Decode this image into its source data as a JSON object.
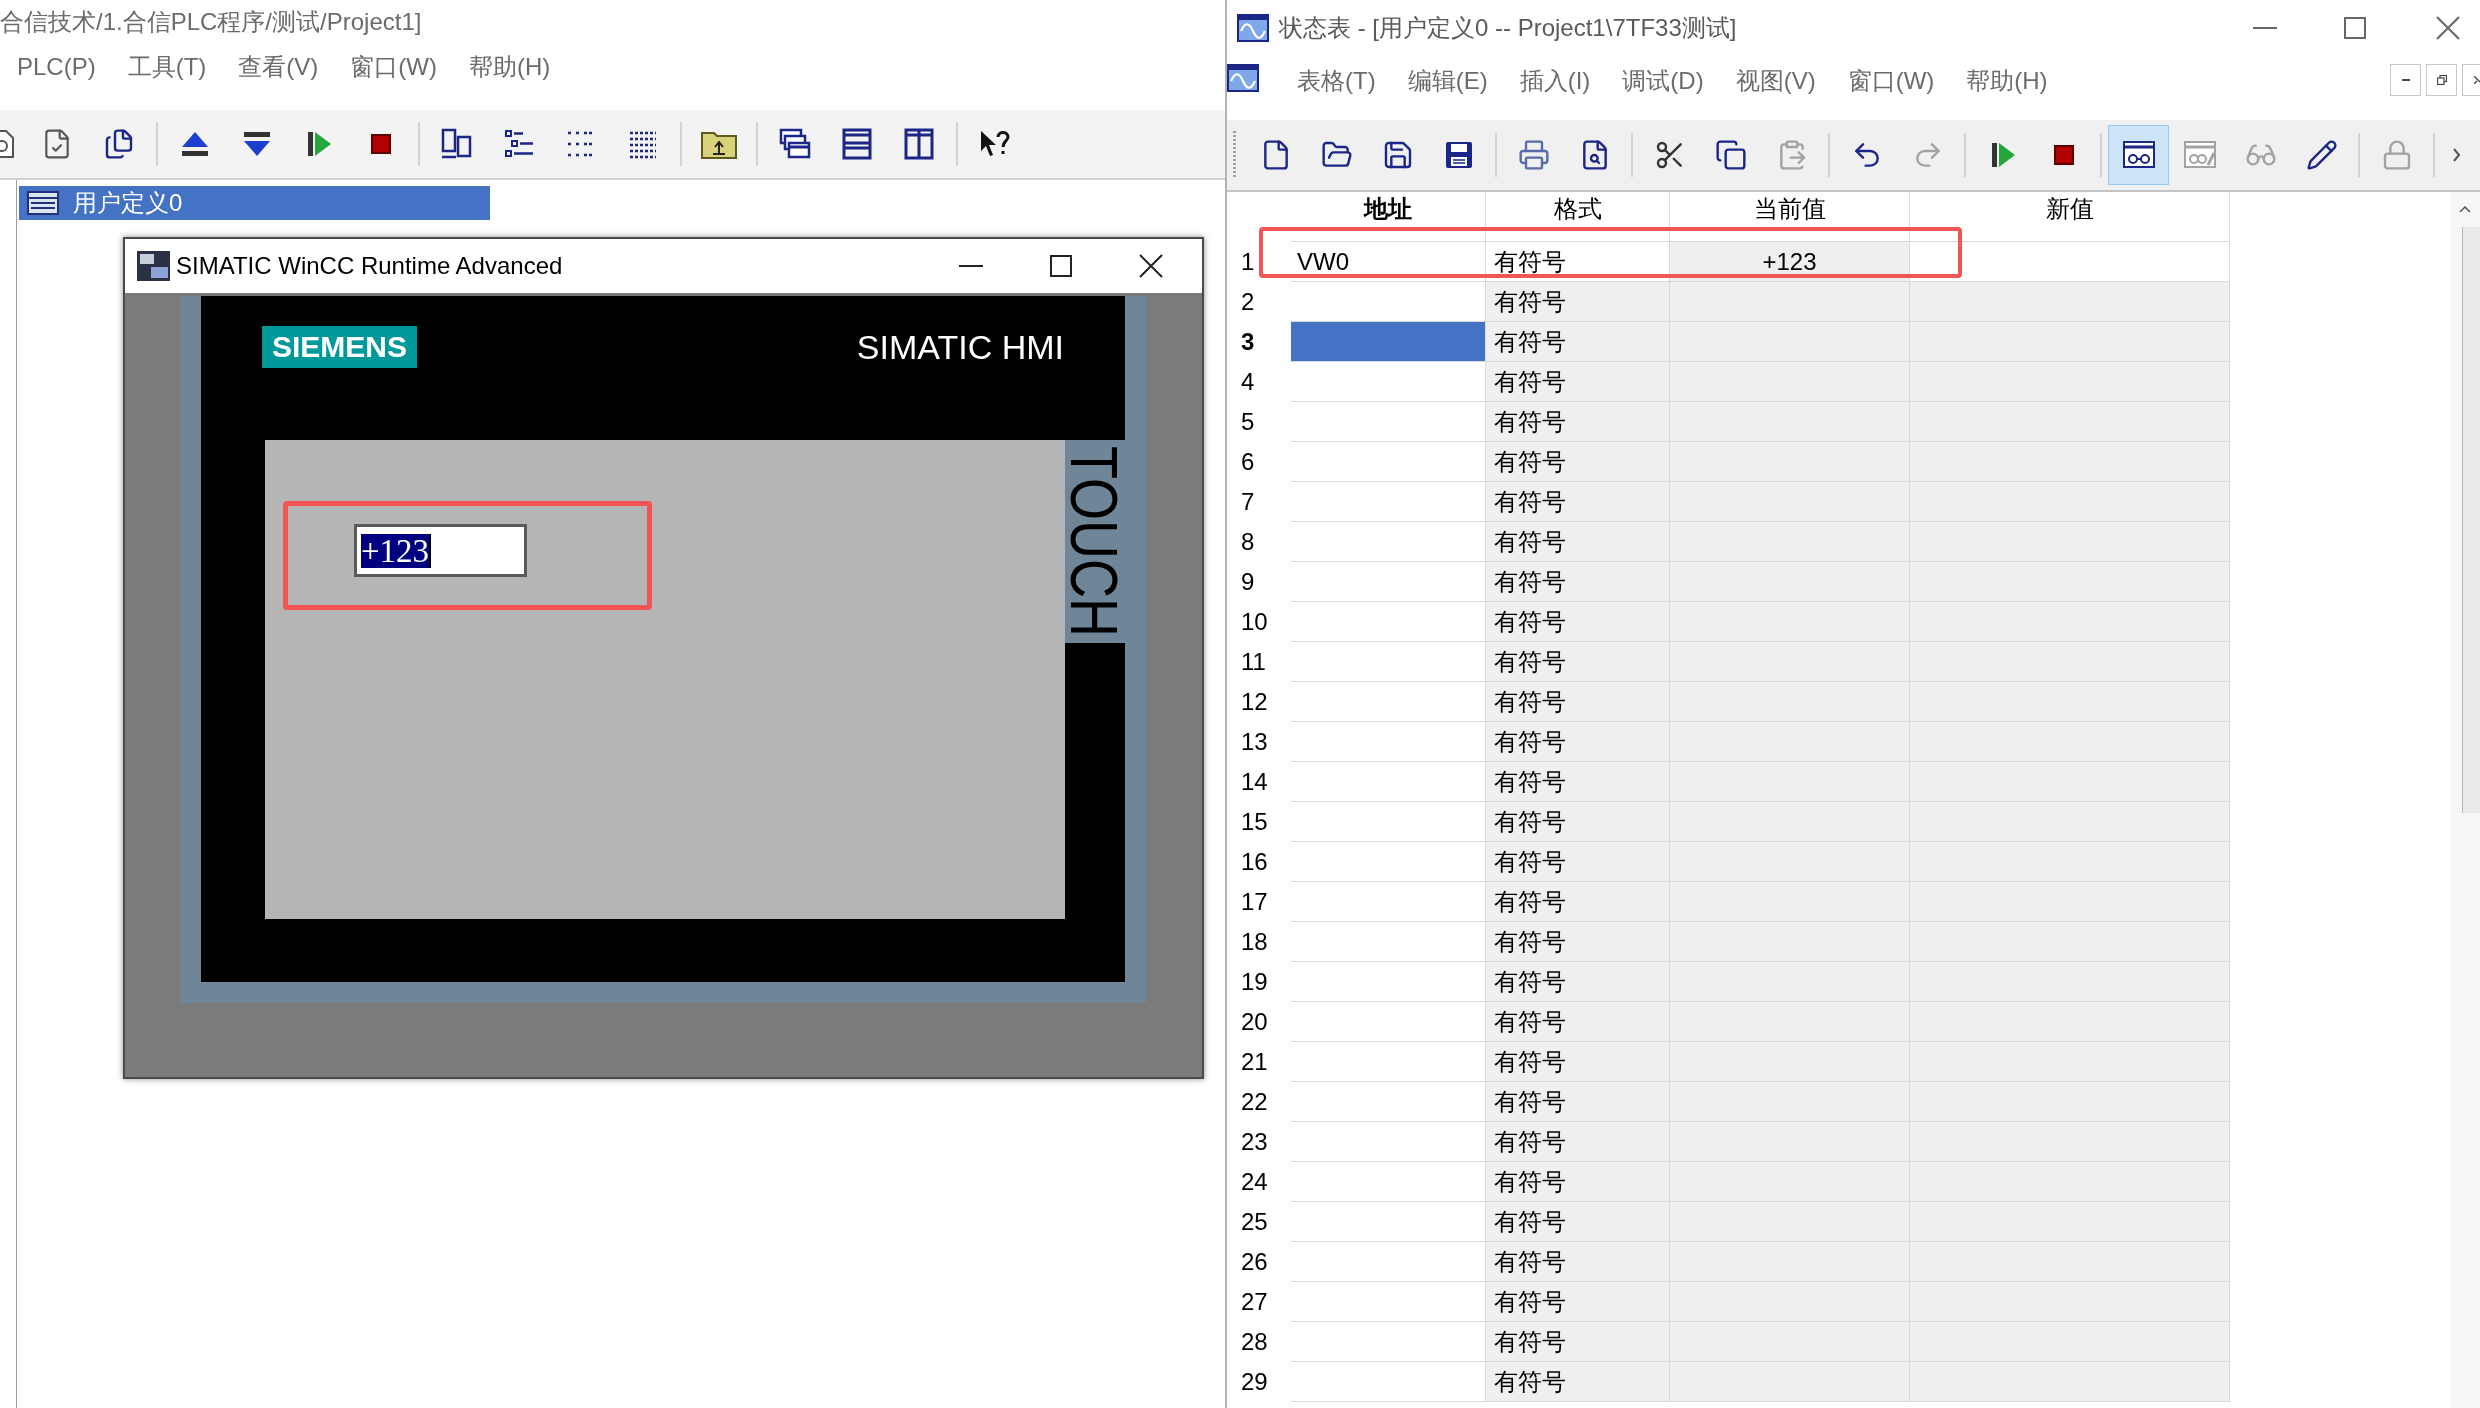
{
  "main_window": {
    "title": "合信技术/1.合信PLC程序/测试/Project1]",
    "menu": [
      "PLC(P)",
      "工具(T)",
      "查看(V)",
      "窗口(W)",
      "帮助(H)"
    ],
    "tree": [
      {
        "label": "用户定义0",
        "selected": true
      }
    ]
  },
  "hmi_window": {
    "title": "SIMATIC WinCC Runtime Advanced",
    "brand": "SIEMENS",
    "panel_label": "SIMATIC HMI",
    "touch_label": "TOUCH",
    "io_field": {
      "value": "+123",
      "selected": true,
      "highlighted": true
    }
  },
  "status_chart": {
    "title": "状态表 - [用户定义0 -- Project1\\7TF33测试]",
    "menu": [
      "表格(T)",
      "编辑(E)",
      "插入(I)",
      "调试(D)",
      "视图(V)",
      "窗口(W)",
      "帮助(H)"
    ],
    "toolbar": [
      {
        "selected": false,
        "disabled": false
      },
      {
        "selected": false,
        "disabled": false
      },
      {
        "selected": false,
        "disabled": false
      },
      {
        "selected": false,
        "disabled": false
      },
      {
        "selected": false,
        "disabled": false
      },
      {
        "selected": false,
        "disabled": false
      },
      {
        "selected": false,
        "disabled": false
      },
      {
        "selected": false,
        "disabled": false
      },
      {
        "selected": false,
        "disabled": true
      },
      {
        "selected": false,
        "disabled": false
      },
      {
        "selected": false,
        "disabled": true
      },
      {
        "selected": false,
        "disabled": false
      },
      {
        "selected": false,
        "disabled": false
      },
      {
        "selected": true,
        "disabled": false
      },
      {
        "selected": false,
        "disabled": true
      },
      {
        "selected": false,
        "disabled": true
      },
      {
        "selected": false,
        "disabled": false
      },
      {
        "selected": false,
        "disabled": true
      }
    ],
    "columns": [
      {
        "label": "地址",
        "selected": true
      },
      {
        "label": "格式",
        "selected": false
      },
      {
        "label": "当前值",
        "selected": false
      },
      {
        "label": "新值",
        "selected": false
      }
    ],
    "rows": [
      {
        "number": "1",
        "address": "VW0",
        "format": "有符号",
        "current_value": "+123",
        "selected": false,
        "disabled": false,
        "highlighted": true
      },
      {
        "number": "2",
        "format": "有符号",
        "selected": false,
        "disabled": true,
        "highlighted": false
      },
      {
        "number": "3",
        "format": "有符号",
        "selected": true,
        "disabled": true,
        "highlighted": false
      },
      {
        "number": "4",
        "format": "有符号",
        "selected": false,
        "disabled": true,
        "highlighted": false
      },
      {
        "number": "5",
        "format": "有符号",
        "selected": false,
        "disabled": true,
        "highlighted": false
      },
      {
        "number": "6",
        "format": "有符号",
        "selected": false,
        "disabled": true,
        "highlighted": false
      },
      {
        "number": "7",
        "format": "有符号",
        "selected": false,
        "disabled": true,
        "highlighted": false
      },
      {
        "number": "8",
        "format": "有符号",
        "selected": false,
        "disabled": true,
        "highlighted": false
      },
      {
        "number": "9",
        "format": "有符号",
        "selected": false,
        "disabled": true,
        "highlighted": false
      },
      {
        "number": "10",
        "format": "有符号",
        "selected": false,
        "disabled": true,
        "highlighted": false
      },
      {
        "number": "11",
        "format": "有符号",
        "selected": false,
        "disabled": true,
        "highlighted": false
      },
      {
        "number": "12",
        "format": "有符号",
        "selected": false,
        "disabled": true,
        "highlighted": false
      },
      {
        "number": "13",
        "format": "有符号",
        "selected": false,
        "disabled": true,
        "highlighted": false
      },
      {
        "number": "14",
        "format": "有符号",
        "selected": false,
        "disabled": true,
        "highlighted": false
      },
      {
        "number": "15",
        "format": "有符号",
        "selected": false,
        "disabled": true,
        "highlighted": false
      },
      {
        "number": "16",
        "format": "有符号",
        "selected": false,
        "disabled": true,
        "highlighted": false
      },
      {
        "number": "17",
        "format": "有符号",
        "selected": false,
        "disabled": true,
        "highlighted": false
      },
      {
        "number": "18",
        "format": "有符号",
        "selected": false,
        "disabled": true,
        "highlighted": false
      },
      {
        "number": "19",
        "format": "有符号",
        "selected": false,
        "disabled": true,
        "highlighted": false
      },
      {
        "number": "20",
        "format": "有符号",
        "selected": false,
        "disabled": true,
        "highlighted": false
      },
      {
        "number": "21",
        "format": "有符号",
        "selected": false,
        "disabled": true,
        "highlighted": false
      },
      {
        "number": "22",
        "format": "有符号",
        "selected": false,
        "disabled": true,
        "highlighted": false
      },
      {
        "number": "23",
        "format": "有符号",
        "selected": false,
        "disabled": true,
        "highlighted": false
      },
      {
        "number": "24",
        "format": "有符号",
        "selected": false,
        "disabled": true,
        "highlighted": false
      },
      {
        "number": "25",
        "format": "有符号",
        "selected": false,
        "disabled": true,
        "highlighted": false
      },
      {
        "number": "26",
        "format": "有符号",
        "selected": false,
        "disabled": true,
        "highlighted": false
      },
      {
        "number": "27",
        "format": "有符号",
        "selected": false,
        "disabled": true,
        "highlighted": false
      },
      {
        "number": "28",
        "format": "有符号",
        "selected": false,
        "disabled": true,
        "highlighted": false
      },
      {
        "number": "29",
        "format": "有符号",
        "selected": false,
        "disabled": true,
        "highlighted": false
      }
    ]
  }
}
